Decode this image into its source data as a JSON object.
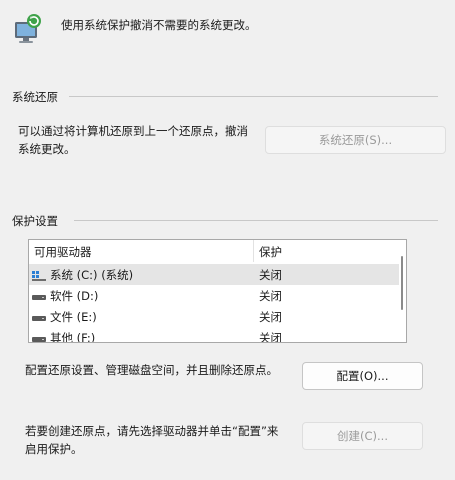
{
  "header": {
    "description": "使用系统保护撤消不需要的系统更改。",
    "icon": "system-protection-icon"
  },
  "restore_section": {
    "title": "系统还原",
    "description_line1": "可以通过将计算机还原到上一个还原点，撤消",
    "description_line2": "系统更改。",
    "button_label": "系统还原(S)..."
  },
  "protection_section": {
    "title": "保护设置",
    "columns": [
      "可用驱动器",
      "保护"
    ],
    "drives": [
      {
        "name": "系统 (C:) (系统)",
        "protection": "关闭",
        "icon": "windows-drive-icon",
        "selected": true
      },
      {
        "name": "软件 (D:)",
        "protection": "关闭",
        "icon": "drive-icon",
        "selected": false
      },
      {
        "name": "文件 (E:)",
        "protection": "关闭",
        "icon": "drive-icon",
        "selected": false
      },
      {
        "name": "其他 (F:)",
        "protection": "关闭",
        "icon": "drive-icon",
        "selected": false
      }
    ],
    "configure_text": "配置还原设置、管理磁盘空间，并且删除还原点。",
    "configure_button": "配置(O)...",
    "create_text_line1": "若要创建还原点，请先选择驱动器并单击“配置”来",
    "create_text_line2": "启用保护。",
    "create_button": "创建(C)..."
  },
  "colors": {
    "background": "#f0f0f0",
    "selected_row": "#e5e5e5",
    "disabled_text": "#9a9a9a"
  }
}
